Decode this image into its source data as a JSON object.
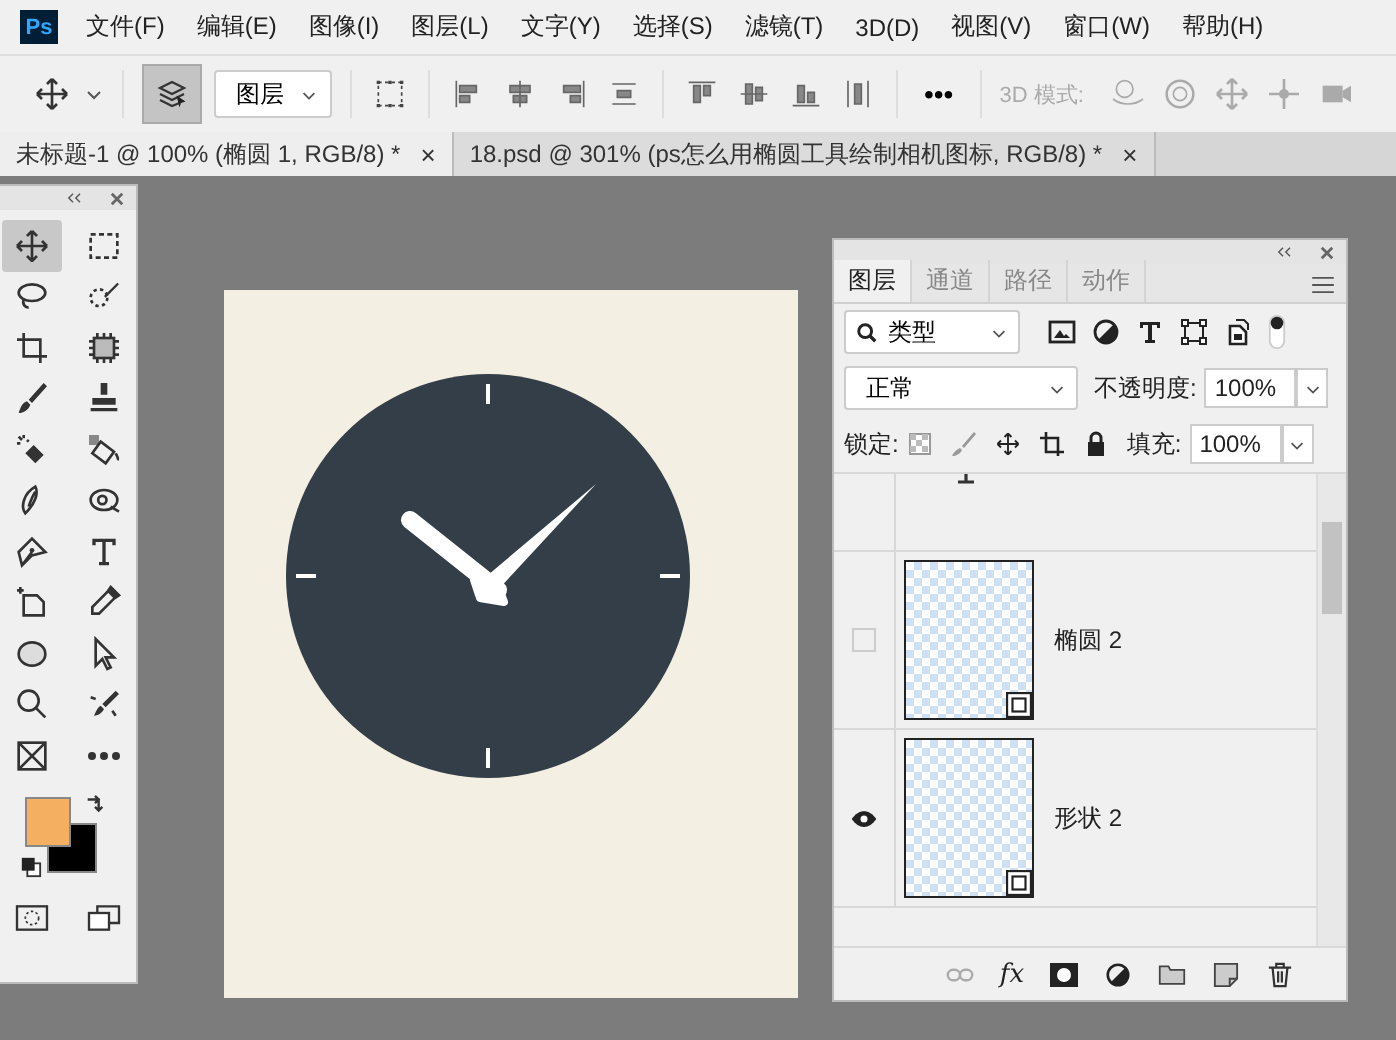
{
  "app_logo": "Ps",
  "menu": [
    "文件(F)",
    "编辑(E)",
    "图像(I)",
    "图层(L)",
    "文字(Y)",
    "选择(S)",
    "滤镜(T)",
    "3D(D)",
    "视图(V)",
    "窗口(W)",
    "帮助(H)"
  ],
  "options_bar": {
    "auto_select": {
      "selected": true
    },
    "target_dropdown": "图层",
    "more": "•••",
    "mode_label": "3D 模式:"
  },
  "doc_tabs": [
    {
      "title": "未标题-1 @ 100% (椭圆 1, RGB/8) *",
      "selected": true,
      "close": "×"
    },
    {
      "title": "18.psd @ 301% (ps怎么用椭圆工具绘制相机图标, RGB/8) *",
      "selected": false,
      "close": "×"
    }
  ],
  "tools": [
    {
      "kind": "move",
      "selected": true
    },
    {
      "kind": "marquee",
      "selected": false
    },
    {
      "kind": "lasso",
      "selected": false
    },
    {
      "kind": "quickselect",
      "selected": false
    },
    {
      "kind": "crop",
      "selected": false
    },
    {
      "kind": "frame",
      "selected": false
    },
    {
      "kind": "brush",
      "selected": false
    },
    {
      "kind": "stamp",
      "selected": false
    },
    {
      "kind": "eraser",
      "selected": false
    },
    {
      "kind": "bucket",
      "selected": false
    },
    {
      "kind": "smudge",
      "selected": false
    },
    {
      "kind": "dodge",
      "selected": false
    },
    {
      "kind": "pen",
      "selected": false
    },
    {
      "kind": "type",
      "selected": false
    },
    {
      "kind": "pathselect",
      "selected": false
    },
    {
      "kind": "eyedropper",
      "selected": false
    },
    {
      "kind": "ellipse",
      "selected": false
    },
    {
      "kind": "arrow",
      "selected": false
    },
    {
      "kind": "zoom",
      "selected": false
    },
    {
      "kind": "retouch",
      "selected": false
    },
    {
      "kind": "frameX",
      "selected": false
    },
    {
      "kind": "more",
      "selected": false
    }
  ],
  "layers_panel": {
    "tabs": [
      {
        "label": "图层",
        "selected": true
      },
      {
        "label": "通道",
        "selected": false
      },
      {
        "label": "路径",
        "selected": false
      },
      {
        "label": "动作",
        "selected": false
      }
    ],
    "filter": "类型",
    "blend_mode": "正常",
    "opacity_label": "不透明度:",
    "opacity": "100%",
    "lock_label": "锁定:",
    "fill_label": "填充:",
    "fill": "100%",
    "layers": [
      {
        "name": "椭圆 2",
        "visible": false
      },
      {
        "name": "形状 2",
        "visible": true
      }
    ],
    "fx": "fx"
  }
}
